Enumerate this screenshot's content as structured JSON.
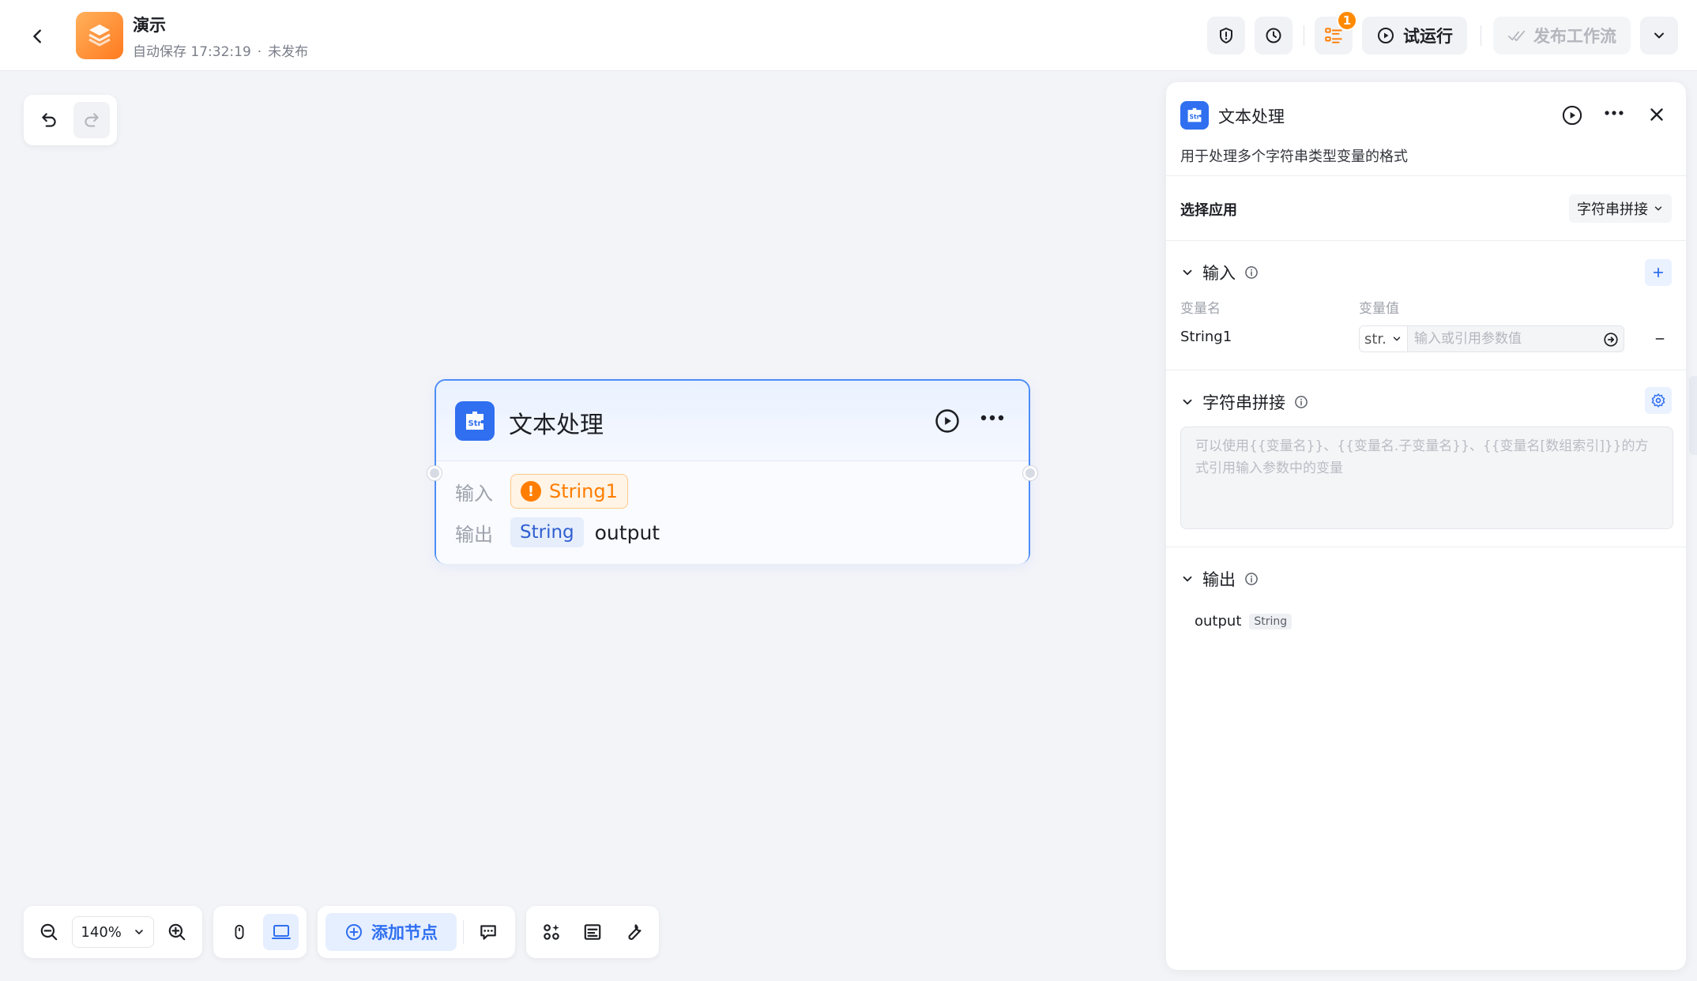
{
  "header": {
    "title": "演示",
    "autosave": "自动保存 17:32:19",
    "separator": "·",
    "publish_state": "未发布",
    "badge_count": "1",
    "test_run_label": "试运行",
    "publish_label": "发布工作流"
  },
  "node": {
    "title": "文本处理",
    "input_label": "输入",
    "input_var": "String1",
    "warn_glyph": "!",
    "output_label": "输出",
    "output_type": "String",
    "output_name": "output",
    "icon_text": "Str"
  },
  "toolbar": {
    "zoom": "140%",
    "add_node_label": "添加节点"
  },
  "panel": {
    "title": "文本处理",
    "description": "用于处理多个字符串类型变量的格式",
    "select_app_label": "选择应用",
    "select_app_value": "字符串拼接",
    "input_section": "输入",
    "col_name": "变量名",
    "col_value": "变量值",
    "var_name": "String1",
    "var_type": "str.",
    "var_placeholder": "输入或引用参数值",
    "concat_section": "字符串拼接",
    "template_placeholder": "可以使用{{变量名}}、{{变量名.子变量名}}、{{变量名[数组索引]}}的方式引用输入参数中的变量",
    "output_section": "输出",
    "output_name": "output",
    "output_type": "String"
  },
  "colors": {
    "accent": "#2f6ff0",
    "warning": "#ff7d00",
    "node_border": "#4d8df7",
    "brand_orange": "#ff8a00"
  },
  "icons": [
    "back-arrow-icon",
    "app-logo-icon",
    "shield-icon",
    "clock-icon",
    "checklist-icon",
    "play-icon",
    "double-check-icon",
    "chevron-down-icon",
    "undo-icon",
    "redo-icon",
    "str-icon",
    "more-icon",
    "zoom-out-icon",
    "zoom-in-icon",
    "mouse-icon",
    "touchpad-icon",
    "plus-circle-icon",
    "comment-icon",
    "apps-icon",
    "layout-icon",
    "wrench-icon",
    "close-icon",
    "info-icon",
    "plus-icon",
    "minus-icon",
    "gear-icon",
    "reference-icon"
  ]
}
